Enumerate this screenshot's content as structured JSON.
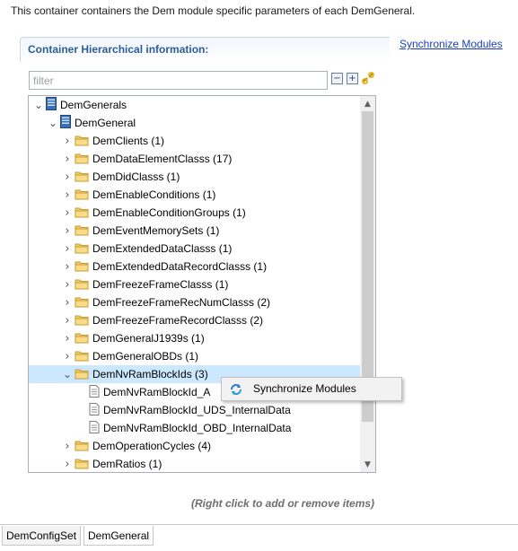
{
  "description": "This container containers the Dem module specific parameters of each DemGeneral.",
  "section": {
    "title": "Container Hierarchical information:",
    "sync_link": "Synchronize Modules"
  },
  "filter": {
    "placeholder": "filter",
    "value": ""
  },
  "toolbar": {
    "collapse_icon": "collapse-all-icon",
    "expand_icon": "expand-all-icon",
    "link_icon": "link-with-editor-icon"
  },
  "tree": {
    "items": [
      {
        "label": "DemGenerals",
        "level": 0,
        "icon": "module-icon",
        "expanded": true
      },
      {
        "label": "DemGeneral",
        "level": 1,
        "icon": "module-icon",
        "expanded": true
      },
      {
        "label": "DemClients (1)",
        "level": 2,
        "icon": "folder-icon",
        "expanded": false
      },
      {
        "label": "DemDataElementClasss (17)",
        "level": 2,
        "icon": "folder-icon",
        "expanded": false
      },
      {
        "label": "DemDidClasss (1)",
        "level": 2,
        "icon": "folder-icon",
        "expanded": false
      },
      {
        "label": "DemEnableConditions (1)",
        "level": 2,
        "icon": "folder-icon",
        "expanded": false
      },
      {
        "label": "DemEnableConditionGroups (1)",
        "level": 2,
        "icon": "folder-icon",
        "expanded": false
      },
      {
        "label": "DemEventMemorySets (1)",
        "level": 2,
        "icon": "folder-icon",
        "expanded": false
      },
      {
        "label": "DemExtendedDataClasss (1)",
        "level": 2,
        "icon": "folder-icon",
        "expanded": false
      },
      {
        "label": "DemExtendedDataRecordClasss (1)",
        "level": 2,
        "icon": "folder-icon",
        "expanded": false
      },
      {
        "label": "DemFreezeFrameClasss (1)",
        "level": 2,
        "icon": "folder-icon",
        "expanded": false
      },
      {
        "label": "DemFreezeFrameRecNumClasss (2)",
        "level": 2,
        "icon": "folder-icon",
        "expanded": false
      },
      {
        "label": "DemFreezeFrameRecordClasss (2)",
        "level": 2,
        "icon": "folder-icon",
        "expanded": false
      },
      {
        "label": "DemGeneralJ1939s (1)",
        "level": 2,
        "icon": "folder-icon",
        "expanded": false
      },
      {
        "label": "DemGeneralOBDs (1)",
        "level": 2,
        "icon": "folder-icon",
        "expanded": false
      },
      {
        "label": "DemNvRamBlockIds (3)",
        "level": 2,
        "icon": "folder-icon",
        "expanded": true,
        "selected": true
      },
      {
        "label": "DemNvRamBlockId_A",
        "level": 3,
        "icon": "document-icon",
        "leaf": true
      },
      {
        "label": "DemNvRamBlockId_UDS_InternalData",
        "level": 3,
        "icon": "document-icon",
        "leaf": true
      },
      {
        "label": "DemNvRamBlockId_OBD_InternalData",
        "level": 3,
        "icon": "document-icon",
        "leaf": true
      },
      {
        "label": "DemOperationCycles (4)",
        "level": 2,
        "icon": "folder-icon",
        "expanded": false
      },
      {
        "label": "DemRatios (1)",
        "level": 2,
        "icon": "folder-icon",
        "expanded": false
      }
    ]
  },
  "context_menu": {
    "items": [
      {
        "label": "Synchronize Modules",
        "icon": "sync-icon"
      }
    ]
  },
  "hint": "(Right click to add or remove items)",
  "tabs": [
    {
      "label": "DemConfigSet",
      "active": false
    },
    {
      "label": "DemGeneral",
      "active": true
    }
  ],
  "colors": {
    "section_title": "#2a5d9a",
    "link": "#1a40c0",
    "selection": "#cce8ff",
    "folder": "#f0c75e"
  }
}
